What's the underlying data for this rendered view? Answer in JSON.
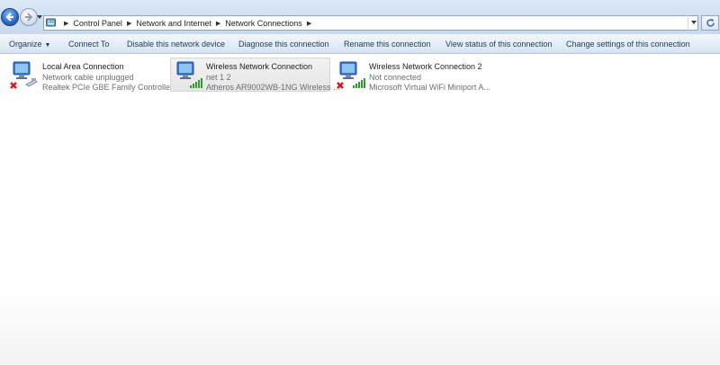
{
  "address_bar": {
    "crumbs": [
      "Control Panel",
      "Network and Internet",
      "Network Connections"
    ]
  },
  "command_bar": {
    "organize": "Organize",
    "connect_to": "Connect To",
    "disable": "Disable this network device",
    "diagnose": "Diagnose this connection",
    "rename": "Rename this connection",
    "view_status": "View status of this connection",
    "change_settings": "Change settings of this connection"
  },
  "connections": [
    {
      "name": "Local Area Connection",
      "status": "Network cable unplugged",
      "adapter": "Realtek PCIe GBE Family Controller",
      "icon": "wired-network-disconnected-icon"
    },
    {
      "name": "Wireless Network Connection",
      "status": "net 1  2",
      "adapter": "Atheros AR9002WB-1NG Wireless ...",
      "icon": "wireless-network-connected-icon"
    },
    {
      "name": "Wireless Network Connection 2",
      "status": "Not connected",
      "adapter": "Microsoft Virtual WiFi Miniport A...",
      "icon": "wireless-network-disconnected-icon"
    }
  ],
  "colors": {
    "command_text": "#1e395b",
    "selection_bg": "#e9e9e9",
    "error_red": "#d2161d",
    "signal_green": "#2f9a2f"
  }
}
